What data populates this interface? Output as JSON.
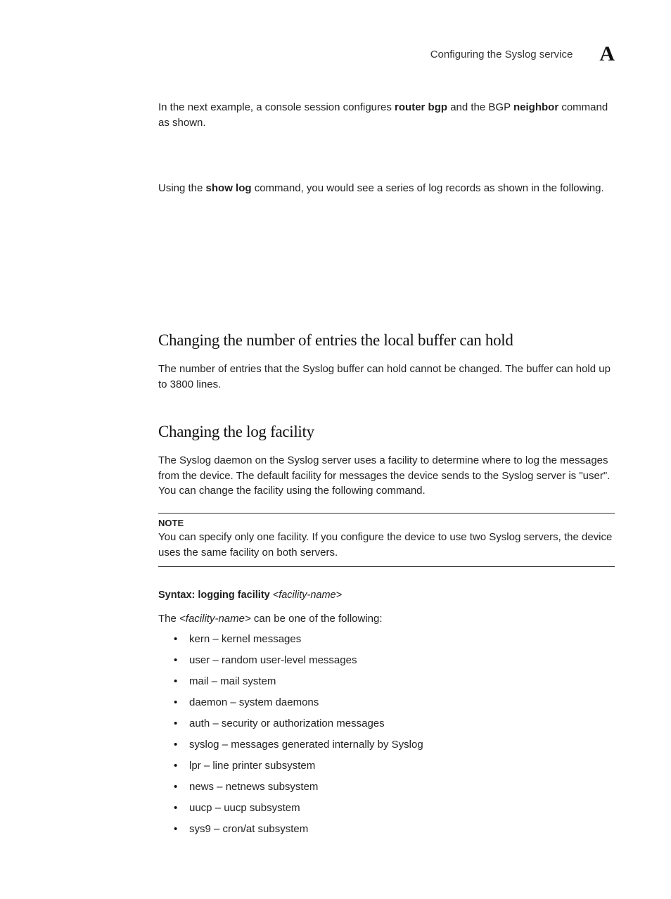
{
  "header": {
    "title": "Configuring the Syslog service",
    "letter": "A"
  },
  "intro": {
    "p1_a": "In the next example, a console session configures ",
    "p1_b": "router bgp",
    "p1_c": " and the BGP ",
    "p1_d": "neighbor",
    "p1_e": " command as shown.",
    "p2_a": "Using the ",
    "p2_b": "show log",
    "p2_c": " command, you would see a series of log records as shown in the following."
  },
  "section1": {
    "heading": "Changing the number of entries the local buffer can hold",
    "body": "The number of entries that the Syslog buffer can hold cannot be changed. The buffer can hold up to 3800 lines."
  },
  "section2": {
    "heading": "Changing the log facility",
    "body": "The Syslog daemon on the Syslog server uses a facility to determine where to log the messages from the device. The default facility for messages the device sends to the Syslog server is \"user\". You can change the facility using the following command.",
    "note_label": "NOTE",
    "note_body": "You can specify only one facility. If you configure the device to use two Syslog servers, the device uses the same facility on both servers.",
    "syntax_prefix": "Syntax:  logging facility ",
    "syntax_arg": "<facility-name>",
    "facility_intro_a": "The ",
    "facility_intro_b": "<facility-name>",
    "facility_intro_c": " can be one of the following:",
    "items": [
      "kern – kernel messages",
      "user – random user-level messages",
      "mail – mail system",
      "daemon – system daemons",
      "auth – security or authorization messages",
      "syslog – messages generated internally by Syslog",
      "lpr – line printer subsystem",
      "news – netnews subsystem",
      "uucp – uucp subsystem",
      "sys9 – cron/at subsystem"
    ]
  }
}
